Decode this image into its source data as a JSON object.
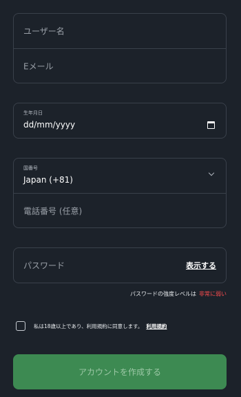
{
  "account": {
    "username_placeholder": "ユーザー名",
    "email_placeholder": "Eメール"
  },
  "birthdate": {
    "label": "生年月日",
    "value": "dd/mm/yyyy",
    "icon": "calendar-icon"
  },
  "phone": {
    "country_label": "国番号",
    "country_value": "Japan (+81)",
    "chevron_icon": "chevron-down-icon",
    "number_placeholder": "電話番号 (任意)"
  },
  "password": {
    "placeholder": "パスワード",
    "show_label": "表示する",
    "strength_prefix": "パスワードの強度レベルは",
    "strength_level": "非常に弱い",
    "strength_color": "#ff4d4f"
  },
  "terms": {
    "text": "私は18歳以上であり、利用規約に同意します。",
    "link": "利用規約",
    "checked": false
  },
  "submit": {
    "label": "アカウントを作成する",
    "color": "#3d8a52"
  }
}
